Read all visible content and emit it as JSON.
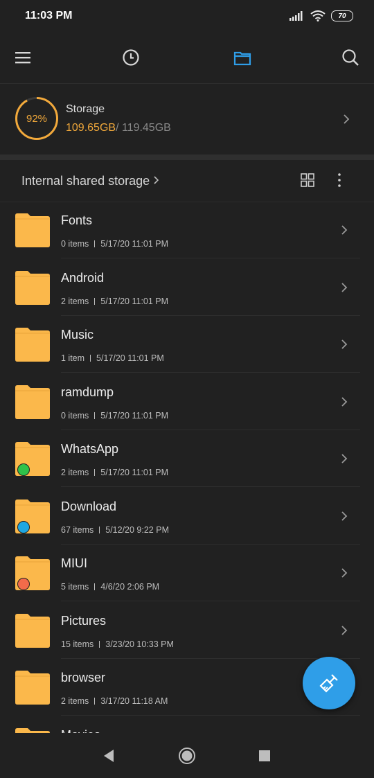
{
  "status_bar": {
    "time": "11:03 PM",
    "battery": "70"
  },
  "toolbar": {
    "icons": [
      "menu-icon",
      "clock-icon",
      "folder-icon",
      "search-icon"
    ],
    "active_color": "#2f9ee8"
  },
  "storage": {
    "percent_label": "92%",
    "percent": 0.92,
    "label": "Storage",
    "used": "109.65GB",
    "total": "/ 119.45GB",
    "accent": "#f2a93b"
  },
  "path": {
    "label": "Internal shared storage"
  },
  "folders": [
    {
      "name": "Fonts",
      "count": "0 items",
      "date": "5/17/20 11:01 PM",
      "badge": null
    },
    {
      "name": "Android",
      "count": "2 items",
      "date": "5/17/20 11:01 PM",
      "badge": null
    },
    {
      "name": "Music",
      "count": "1 item",
      "date": "5/17/20 11:01 PM",
      "badge": null
    },
    {
      "name": "ramdump",
      "count": "0 items",
      "date": "5/17/20 11:01 PM",
      "badge": null
    },
    {
      "name": "WhatsApp",
      "count": "2 items",
      "date": "5/17/20 11:01 PM",
      "badge": "whatsapp-icon"
    },
    {
      "name": "Download",
      "count": "67 items",
      "date": "5/12/20 9:22 PM",
      "badge": "download-icon"
    },
    {
      "name": "MIUI",
      "count": "5 items",
      "date": "4/6/20 2:06 PM",
      "badge": "miui-icon"
    },
    {
      "name": "Pictures",
      "count": "15 items",
      "date": "3/23/20 10:33 PM",
      "badge": null
    },
    {
      "name": "browser",
      "count": "2 items",
      "date": "3/17/20 11:18 AM",
      "badge": null
    },
    {
      "name": "Movies",
      "count": "",
      "date": "",
      "badge": null
    }
  ],
  "badge_colors": {
    "whatsapp-icon": "#2fc24a",
    "download-icon": "#1fa7e0",
    "miui-icon": "#f26b4a"
  },
  "folder_color": "#fbb84b",
  "fab": {
    "icon": "broom-icon"
  },
  "nav": [
    "back-icon",
    "home-icon",
    "recents-icon"
  ]
}
